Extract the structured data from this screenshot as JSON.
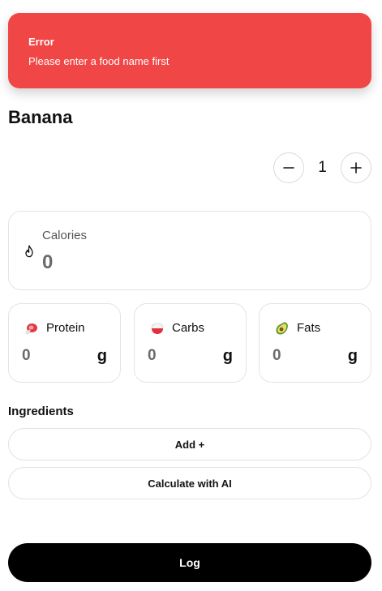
{
  "toast": {
    "title": "Error",
    "message": "Please enter a food name first",
    "color": "#f04646"
  },
  "food": {
    "name": "Banana"
  },
  "quantity": {
    "value": "1",
    "decrement_icon": "minus-icon",
    "increment_icon": "plus-icon"
  },
  "calories": {
    "label": "Calories",
    "value": "0",
    "icon": "flame-icon"
  },
  "macros": [
    {
      "label": "Protein",
      "value": "0",
      "unit": "g",
      "icon": "meat-icon"
    },
    {
      "label": "Carbs",
      "value": "0",
      "unit": "g",
      "icon": "rice-bowl-icon"
    },
    {
      "label": "Fats",
      "value": "0",
      "unit": "g",
      "icon": "avocado-icon"
    }
  ],
  "ingredients": {
    "heading": "Ingredients",
    "add_label": "Add +",
    "calculate_label": "Calculate with AI"
  },
  "log": {
    "label": "Log"
  }
}
